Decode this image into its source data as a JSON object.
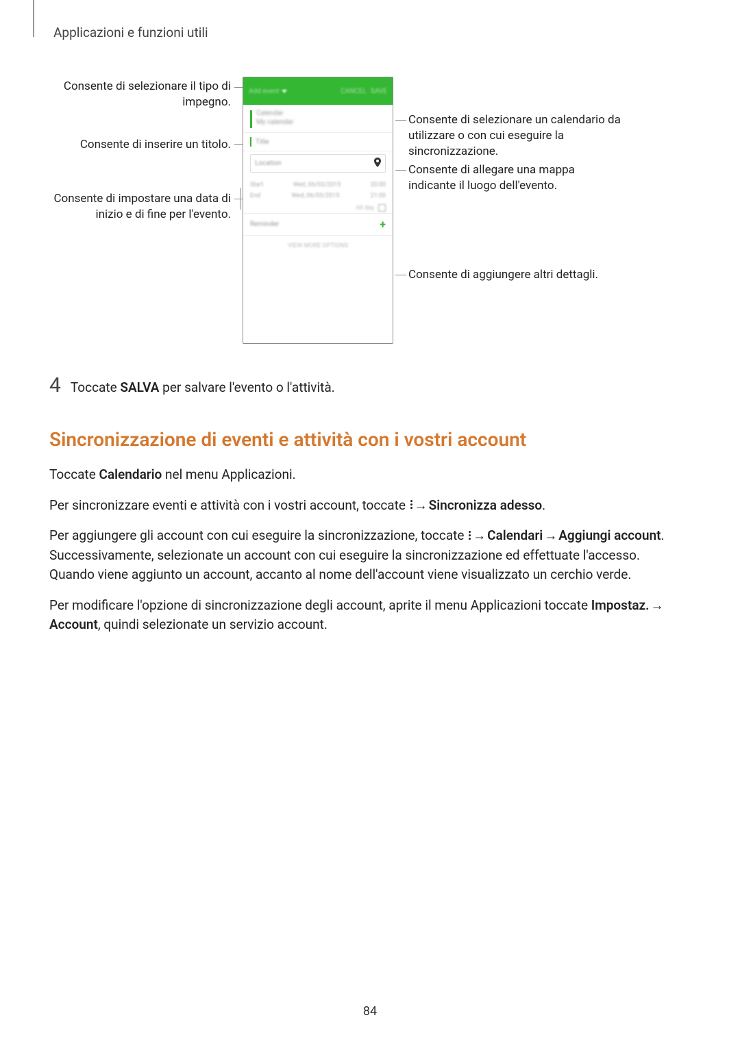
{
  "header": {
    "breadcrumb": "Applicazioni e funzioni utili"
  },
  "diagram": {
    "left": {
      "type": "Consente di selezionare il tipo di impegno.",
      "title": "Consente di inserire un titolo.",
      "dates": "Consente di impostare una data di inizio e di fine per l'evento."
    },
    "right": {
      "calendar": "Consente di selezionare un calendario da utilizzare o con cui eseguire la sincronizzazione.",
      "map": "Consente di allegare una mappa indicante il luogo dell'evento.",
      "details": "Consente di aggiungere altri dettagli."
    },
    "mock": {
      "dropdown": "Add event",
      "cancel": "CANCEL",
      "save": "SAVE",
      "calendar_name": "Calendar",
      "calendar_sub": "My calendar",
      "title_placeholder": "Title",
      "location_placeholder": "Location",
      "start_label": "Start",
      "start_date": "Wed, 06/03/2015",
      "start_time": "20:00",
      "end_label": "End",
      "end_date": "Wed, 06/03/2015",
      "end_time": "21:00",
      "allday": "All day",
      "reminder": "Reminder",
      "view_more": "VIEW MORE OPTIONS"
    }
  },
  "body": {
    "step": {
      "num": "4",
      "text_before": "Toccate ",
      "text_bold": "SALVA",
      "text_after": " per salvare l'evento o l'attività."
    },
    "section_heading": "Sincronizzazione di eventi e attività con i vostri account",
    "p1": {
      "a": "Toccate ",
      "b": "Calendario",
      "c": " nel menu Applicazioni."
    },
    "p2": {
      "a": "Per sincronizzare eventi e attività con i vostri account, toccate ",
      "arrow": " → ",
      "b": "Sincronizza adesso",
      "c": "."
    },
    "p3": {
      "a": "Per aggiungere gli account con cui eseguire la sincronizzazione, toccate ",
      "arrow": " → ",
      "b": "Calendari",
      "arrow2": " → ",
      "c": "Aggiungi account",
      "d": ". Successivamente, selezionate un account con cui eseguire la sincronizzazione ed effettuate l'accesso. Quando viene aggiunto un account, accanto al nome dell'account viene visualizzato un cerchio verde."
    },
    "p4": {
      "a": "Per modificare l'opzione di sincronizzazione degli account, aprite il menu Applicazioni toccate ",
      "b": "Impostaz.",
      "arrow": " → ",
      "c": "Account",
      "d": ", quindi selezionate un servizio account."
    }
  },
  "page_number": "84"
}
